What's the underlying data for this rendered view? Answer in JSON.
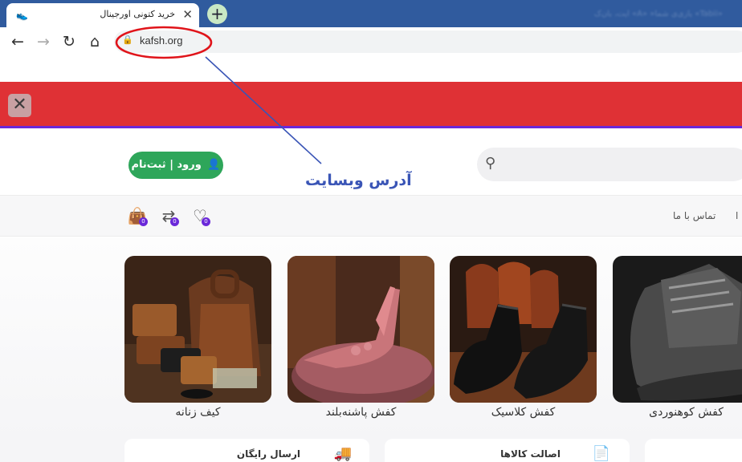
{
  "browser": {
    "tab_title": "خرید کتونی اورجینال",
    "tab_favicon": "shoe-favicon",
    "blurred_profile_text": "«Tabii» یازی‌ی شما«    «A»    ایت، بان‌ک",
    "url": "kafsh.org"
  },
  "header": {
    "login_label": "ورود | ثبت‌نام"
  },
  "nav": {
    "contact_label": "تماس با ما",
    "partial_item_label": "ا",
    "badges": [
      "0",
      "0",
      "0"
    ]
  },
  "products": [
    {
      "label": "کیف زنانه",
      "icon": "leather-bags-photo"
    },
    {
      "label": "کفش پاشنه‌بلند",
      "icon": "high-heel-shoe-photo"
    },
    {
      "label": "کفش کلاسیک",
      "icon": "classic-shoes-photo"
    },
    {
      "label": "کفش کوهنوردی",
      "icon": "hiking-boot-photo"
    }
  ],
  "features": [
    {
      "title": "ارسال رایگان",
      "icon": "delivery-truck-icon"
    },
    {
      "title": "اصالت کالاها",
      "icon": "certificate-icon"
    }
  ],
  "annotation": {
    "label": "آدرس وبسایت",
    "color": "#3a55b6",
    "circle_color": "#e0141a"
  },
  "colors": {
    "tab_strip": "#305b9e",
    "promo_bar": "#df3135",
    "accent_purple": "#6a28d9",
    "login_green": "#2ea65a"
  }
}
